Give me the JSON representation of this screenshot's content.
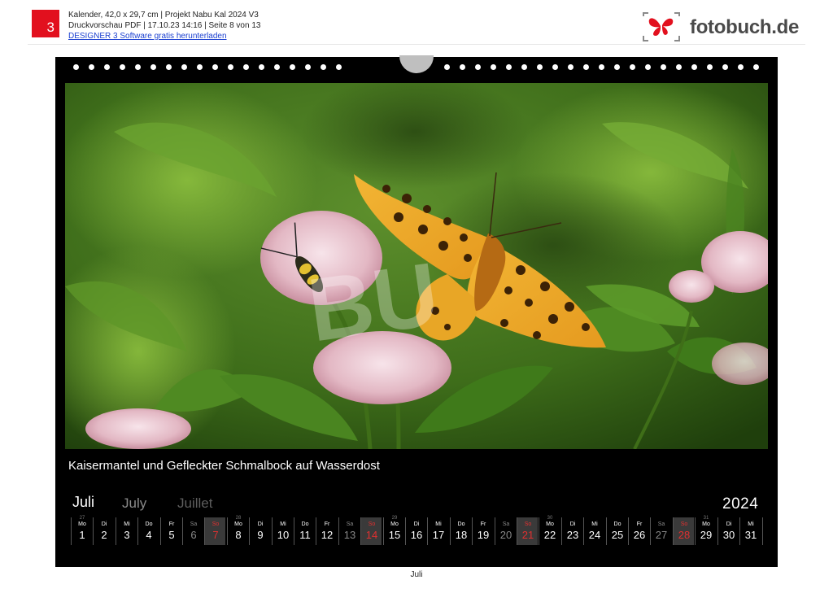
{
  "header": {
    "badge": "3",
    "line1": "Kalender, 42,0 x 29,7 cm | Projekt Nabu Kal 2024 V3",
    "line2": "Druckvorschau PDF | 17.10.23 14:16 | Seite 8 von 13",
    "download_link": "DESIGNER 3 Software gratis herunterladen",
    "logo_text": "fotobuch.de"
  },
  "calendar": {
    "caption": "Kaisermantel und Gefleckter Schmalbock auf Wasserdost",
    "month_de": "Juli",
    "month_en": "July",
    "month_fr": "Juillet",
    "year": "2024",
    "days": [
      {
        "name": "Mo",
        "num": "1",
        "week": "27"
      },
      {
        "name": "Di",
        "num": "2"
      },
      {
        "name": "Mi",
        "num": "3"
      },
      {
        "name": "Do",
        "num": "4"
      },
      {
        "name": "Fr",
        "num": "5"
      },
      {
        "name": "Sa",
        "num": "6"
      },
      {
        "name": "So",
        "num": "7"
      },
      {
        "name": "Mo",
        "num": "8",
        "week": "28"
      },
      {
        "name": "Di",
        "num": "9"
      },
      {
        "name": "Mi",
        "num": "10"
      },
      {
        "name": "Do",
        "num": "11"
      },
      {
        "name": "Fr",
        "num": "12"
      },
      {
        "name": "Sa",
        "num": "13"
      },
      {
        "name": "So",
        "num": "14"
      },
      {
        "name": "Mo",
        "num": "15",
        "week": "29"
      },
      {
        "name": "Di",
        "num": "16"
      },
      {
        "name": "Mi",
        "num": "17"
      },
      {
        "name": "Do",
        "num": "18"
      },
      {
        "name": "Fr",
        "num": "19"
      },
      {
        "name": "Sa",
        "num": "20"
      },
      {
        "name": "So",
        "num": "21"
      },
      {
        "name": "Mo",
        "num": "22",
        "week": "30"
      },
      {
        "name": "Di",
        "num": "23"
      },
      {
        "name": "Mi",
        "num": "24"
      },
      {
        "name": "Do",
        "num": "25"
      },
      {
        "name": "Fr",
        "num": "26"
      },
      {
        "name": "Sa",
        "num": "27"
      },
      {
        "name": "So",
        "num": "28"
      },
      {
        "name": "Mo",
        "num": "29",
        "week": "31"
      },
      {
        "name": "Di",
        "num": "30"
      },
      {
        "name": "Mi",
        "num": "31"
      }
    ]
  },
  "footer": {
    "page_label": "Juli"
  },
  "colors": {
    "brand_red": "#e2101e",
    "sunday_red": "#e03030",
    "sheet_bg": "#000000"
  },
  "icons": {
    "logo": "butterfly-icon"
  }
}
